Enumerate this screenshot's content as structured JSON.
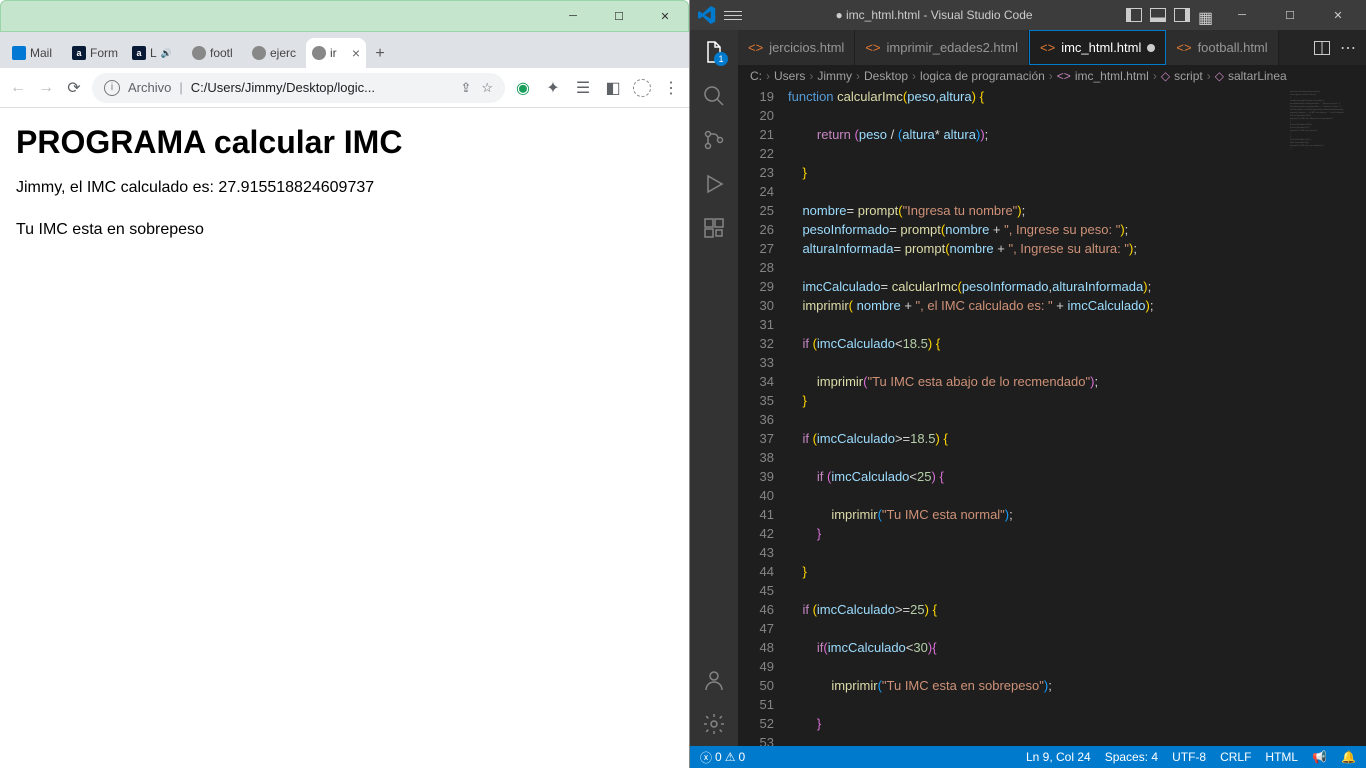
{
  "chrome": {
    "tabs": [
      {
        "label": "Mail",
        "icon": "outlook"
      },
      {
        "label": "Form",
        "icon": "alura"
      },
      {
        "label": "L",
        "icon": "alura",
        "sound": true
      },
      {
        "label": "footl",
        "icon": "globe"
      },
      {
        "label": "ejerc",
        "icon": "globe"
      },
      {
        "label": "ir",
        "icon": "globe",
        "active": true
      }
    ],
    "address_prefix": "Archivo",
    "address": "C:/Users/Jimmy/Desktop/logic...",
    "page": {
      "heading": "PROGRAMA calcular IMC",
      "line1": "Jimmy, el IMC calculado es: 27.915518824609737",
      "line2": "Tu IMC esta en sobrepeso"
    }
  },
  "vscode": {
    "title": "● imc_html.html - Visual Studio Code",
    "tabs": [
      {
        "label": "jercicios.html"
      },
      {
        "label": "imprimir_edades2.html"
      },
      {
        "label": "imc_html.html",
        "active": true,
        "modified": true
      },
      {
        "label": "football.html"
      }
    ],
    "breadcrumbs": [
      "C:",
      "Users",
      "Jimmy",
      "Desktop",
      "logica de programación",
      "imc_html.html",
      "script",
      "saltarLinea"
    ],
    "explorer_badge": "1",
    "code_start_line": 19,
    "code_lines": [
      [
        [
          "kw",
          "function"
        ],
        [
          "pn",
          " "
        ],
        [
          "fn",
          "calcularImc"
        ],
        [
          "brace-y",
          "("
        ],
        [
          "var",
          "peso"
        ],
        [
          "pn",
          ","
        ],
        [
          "var",
          "altura"
        ],
        [
          "brace-y",
          ") "
        ],
        [
          "brace-y",
          "{"
        ]
      ],
      [],
      [
        [
          "pn",
          "        "
        ],
        [
          "ctrl",
          "return"
        ],
        [
          "pn",
          " "
        ],
        [
          "brace-p",
          "("
        ],
        [
          "var",
          "peso"
        ],
        [
          "pn",
          " / "
        ],
        [
          "brace-b",
          "("
        ],
        [
          "var",
          "altura"
        ],
        [
          "pn",
          "* "
        ],
        [
          "var",
          "altura"
        ],
        [
          "brace-b",
          ")"
        ],
        [
          "brace-p",
          ")"
        ],
        [
          "pn",
          ";"
        ]
      ],
      [],
      [
        [
          "pn",
          "    "
        ],
        [
          "brace-y",
          "}"
        ]
      ],
      [],
      [
        [
          "pn",
          "    "
        ],
        [
          "var",
          "nombre"
        ],
        [
          "pn",
          "= "
        ],
        [
          "fn",
          "prompt"
        ],
        [
          "brace-y",
          "("
        ],
        [
          "str",
          "\"Ingresa tu nombre\""
        ],
        [
          "brace-y",
          ")"
        ],
        [
          "pn",
          ";"
        ]
      ],
      [
        [
          "pn",
          "    "
        ],
        [
          "var",
          "pesoInformado"
        ],
        [
          "pn",
          "= "
        ],
        [
          "fn",
          "prompt"
        ],
        [
          "brace-y",
          "("
        ],
        [
          "var",
          "nombre"
        ],
        [
          "pn",
          " + "
        ],
        [
          "str",
          "\", Ingrese su peso: \""
        ],
        [
          "brace-y",
          ")"
        ],
        [
          "pn",
          ";"
        ]
      ],
      [
        [
          "pn",
          "    "
        ],
        [
          "var",
          "alturaInformada"
        ],
        [
          "pn",
          "= "
        ],
        [
          "fn",
          "prompt"
        ],
        [
          "brace-y",
          "("
        ],
        [
          "var",
          "nombre"
        ],
        [
          "pn",
          " + "
        ],
        [
          "str",
          "\", Ingrese su altura: \""
        ],
        [
          "brace-y",
          ")"
        ],
        [
          "pn",
          ";"
        ]
      ],
      [],
      [
        [
          "pn",
          "    "
        ],
        [
          "var",
          "imcCalculado"
        ],
        [
          "pn",
          "= "
        ],
        [
          "fn",
          "calcularImc"
        ],
        [
          "brace-y",
          "("
        ],
        [
          "var",
          "pesoInformado"
        ],
        [
          "pn",
          ","
        ],
        [
          "var",
          "alturaInformada"
        ],
        [
          "brace-y",
          ")"
        ],
        [
          "pn",
          ";"
        ]
      ],
      [
        [
          "pn",
          "    "
        ],
        [
          "fn",
          "imprimir"
        ],
        [
          "brace-y",
          "("
        ],
        [
          "pn",
          " "
        ],
        [
          "var",
          "nombre"
        ],
        [
          "pn",
          " + "
        ],
        [
          "str",
          "\", el IMC calculado es: \""
        ],
        [
          "pn",
          " + "
        ],
        [
          "var",
          "imcCalculado"
        ],
        [
          "brace-y",
          ")"
        ],
        [
          "pn",
          ";"
        ]
      ],
      [],
      [
        [
          "pn",
          "    "
        ],
        [
          "ctrl",
          "if"
        ],
        [
          "pn",
          " "
        ],
        [
          "brace-y",
          "("
        ],
        [
          "var",
          "imcCalculado"
        ],
        [
          "pn",
          "<"
        ],
        [
          "num",
          "18.5"
        ],
        [
          "brace-y",
          ")"
        ],
        [
          "pn",
          " "
        ],
        [
          "brace-y",
          "{"
        ]
      ],
      [],
      [
        [
          "pn",
          "        "
        ],
        [
          "fn",
          "imprimir"
        ],
        [
          "brace-p",
          "("
        ],
        [
          "str",
          "\"Tu IMC esta abajo de lo recmendado\""
        ],
        [
          "brace-p",
          ")"
        ],
        [
          "pn",
          ";"
        ]
      ],
      [
        [
          "pn",
          "    "
        ],
        [
          "brace-y",
          "}"
        ]
      ],
      [],
      [
        [
          "pn",
          "    "
        ],
        [
          "ctrl",
          "if"
        ],
        [
          "pn",
          " "
        ],
        [
          "brace-y",
          "("
        ],
        [
          "var",
          "imcCalculado"
        ],
        [
          "pn",
          ">="
        ],
        [
          "num",
          "18.5"
        ],
        [
          "brace-y",
          ")"
        ],
        [
          "pn",
          " "
        ],
        [
          "brace-y",
          "{"
        ]
      ],
      [],
      [
        [
          "pn",
          "        "
        ],
        [
          "ctrl",
          "if"
        ],
        [
          "pn",
          " "
        ],
        [
          "brace-p",
          "("
        ],
        [
          "var",
          "imcCalculado"
        ],
        [
          "pn",
          "<"
        ],
        [
          "num",
          "25"
        ],
        [
          "brace-p",
          ")"
        ],
        [
          "pn",
          " "
        ],
        [
          "brace-p",
          "{"
        ]
      ],
      [],
      [
        [
          "pn",
          "            "
        ],
        [
          "fn",
          "imprimir"
        ],
        [
          "brace-b",
          "("
        ],
        [
          "str",
          "\"Tu IMC esta normal\""
        ],
        [
          "brace-b",
          ")"
        ],
        [
          "pn",
          ";"
        ]
      ],
      [
        [
          "pn",
          "        "
        ],
        [
          "brace-p",
          "}"
        ]
      ],
      [],
      [
        [
          "pn",
          "    "
        ],
        [
          "brace-y",
          "}"
        ]
      ],
      [],
      [
        [
          "pn",
          "    "
        ],
        [
          "ctrl",
          "if"
        ],
        [
          "pn",
          " "
        ],
        [
          "brace-y",
          "("
        ],
        [
          "var",
          "imcCalculado"
        ],
        [
          "pn",
          ">="
        ],
        [
          "num",
          "25"
        ],
        [
          "brace-y",
          ")"
        ],
        [
          "pn",
          " "
        ],
        [
          "brace-y",
          "{"
        ]
      ],
      [],
      [
        [
          "pn",
          "        "
        ],
        [
          "ctrl",
          "if"
        ],
        [
          "brace-p",
          "("
        ],
        [
          "var",
          "imcCalculado"
        ],
        [
          "pn",
          "<"
        ],
        [
          "num",
          "30"
        ],
        [
          "brace-p",
          ")"
        ],
        [
          "brace-p",
          "{"
        ]
      ],
      [],
      [
        [
          "pn",
          "            "
        ],
        [
          "fn",
          "imprimir"
        ],
        [
          "brace-b",
          "("
        ],
        [
          "str",
          "\"Tu IMC esta en sobrepeso\""
        ],
        [
          "brace-b",
          ")"
        ],
        [
          "pn",
          ";"
        ]
      ],
      [],
      [
        [
          "pn",
          "        "
        ],
        [
          "brace-p",
          "}"
        ]
      ],
      []
    ],
    "status": {
      "errors": "0",
      "warnings": "0",
      "cursor": "Ln 9, Col 24",
      "spaces": "Spaces: 4",
      "encoding": "UTF-8",
      "eol": "CRLF",
      "lang": "HTML"
    }
  }
}
